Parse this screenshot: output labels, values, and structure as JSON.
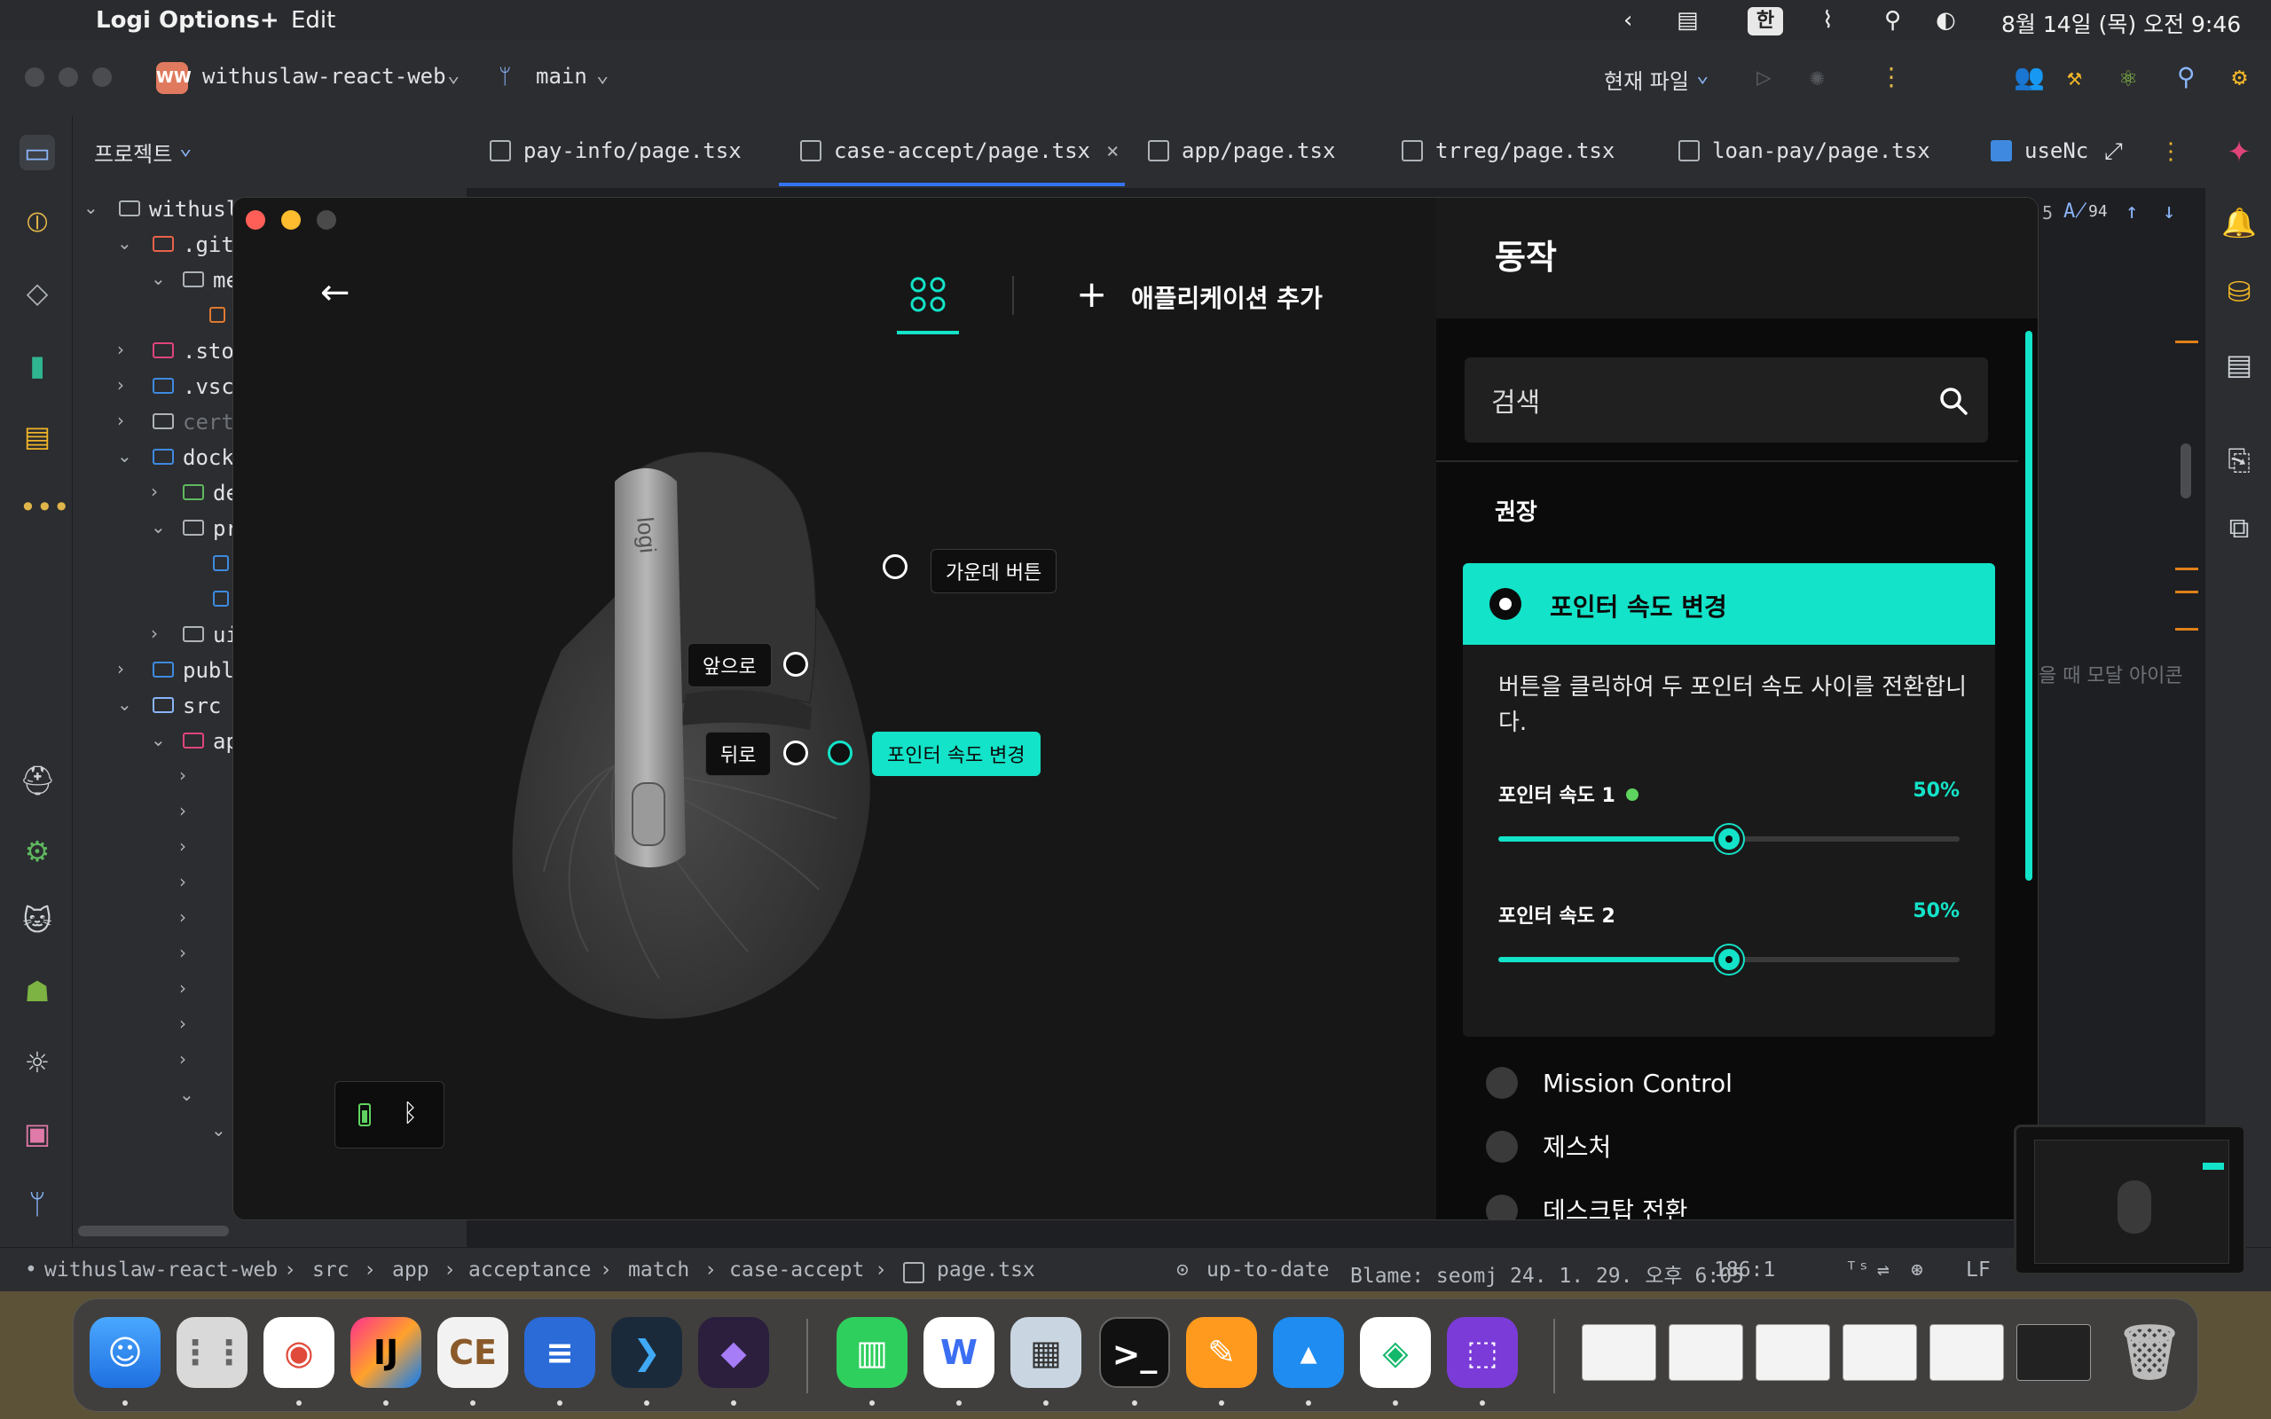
{
  "menubar": {
    "app_name": "Logi Options+",
    "edit": "Edit",
    "input_source": "한",
    "clock": "8월 14일 (목) 오전 9:46"
  },
  "ide": {
    "project_badge": "WW",
    "project_name": "withuslaw-react-web",
    "branch": "main",
    "current_file_label": "현재 파일",
    "project_panel_title": "프로젝트",
    "tree": [
      "withusl",
      ".git",
      "me",
      ".sto",
      ".vsc",
      "cert",
      "dock",
      "de",
      "pr",
      "ui",
      "publ",
      "src",
      "ap"
    ],
    "tabs": [
      "pay-info/page.tsx",
      "case-accept/page.tsx",
      "app/page.tsx",
      "trreg/page.tsx",
      "loan-pay/page.tsx",
      "useNc"
    ],
    "inspection_count": "94",
    "inspection_prefix": "5",
    "editor_snippet": "을 때 모달 아이콘",
    "status": {
      "path": [
        "withuslaw-react-web",
        "src",
        "app",
        "acceptance",
        "match",
        "case-accept",
        "page.tsx"
      ],
      "vcs": "up-to-date",
      "blame": "Blame: seomj 24. 1. 29. 오후 6:05",
      "position": "186:1",
      "line_ending": "LF"
    }
  },
  "logi": {
    "add_app_label": "애플리케이션 추가",
    "mouse_labels": {
      "middle": "가운데 버튼",
      "forward": "앞으로",
      "back": "뒤로",
      "speed": "포인터 속도 변경"
    },
    "mouse_brand": "logi",
    "actions": {
      "title": "동작",
      "search_placeholder": "검색",
      "section_recommended": "권장",
      "selected": {
        "title": "포인터 속도 변경",
        "description": "버튼을 클릭하여 두 포인터 속도 사이를 전환합니다.",
        "speed1_label": "포인터 속도 1",
        "speed1_value": "50%",
        "speed1_fraction": 0.5,
        "speed2_label": "포인터 속도 2",
        "speed2_value": "50%",
        "speed2_fraction": 0.5
      },
      "items": [
        "Mission Control",
        "제스처",
        "데스크탑 전환"
      ]
    },
    "colors": {
      "accent": "#13e3c8"
    }
  },
  "dock": {
    "apps": [
      "finder",
      "launchpad",
      "chrome",
      "intellij",
      "intellij-ce",
      "files",
      "vscode-like",
      "obsidian",
      "numbers",
      "naver-works",
      "preview",
      "terminal",
      "pages",
      "keynote",
      "naver-box",
      "logi"
    ]
  }
}
